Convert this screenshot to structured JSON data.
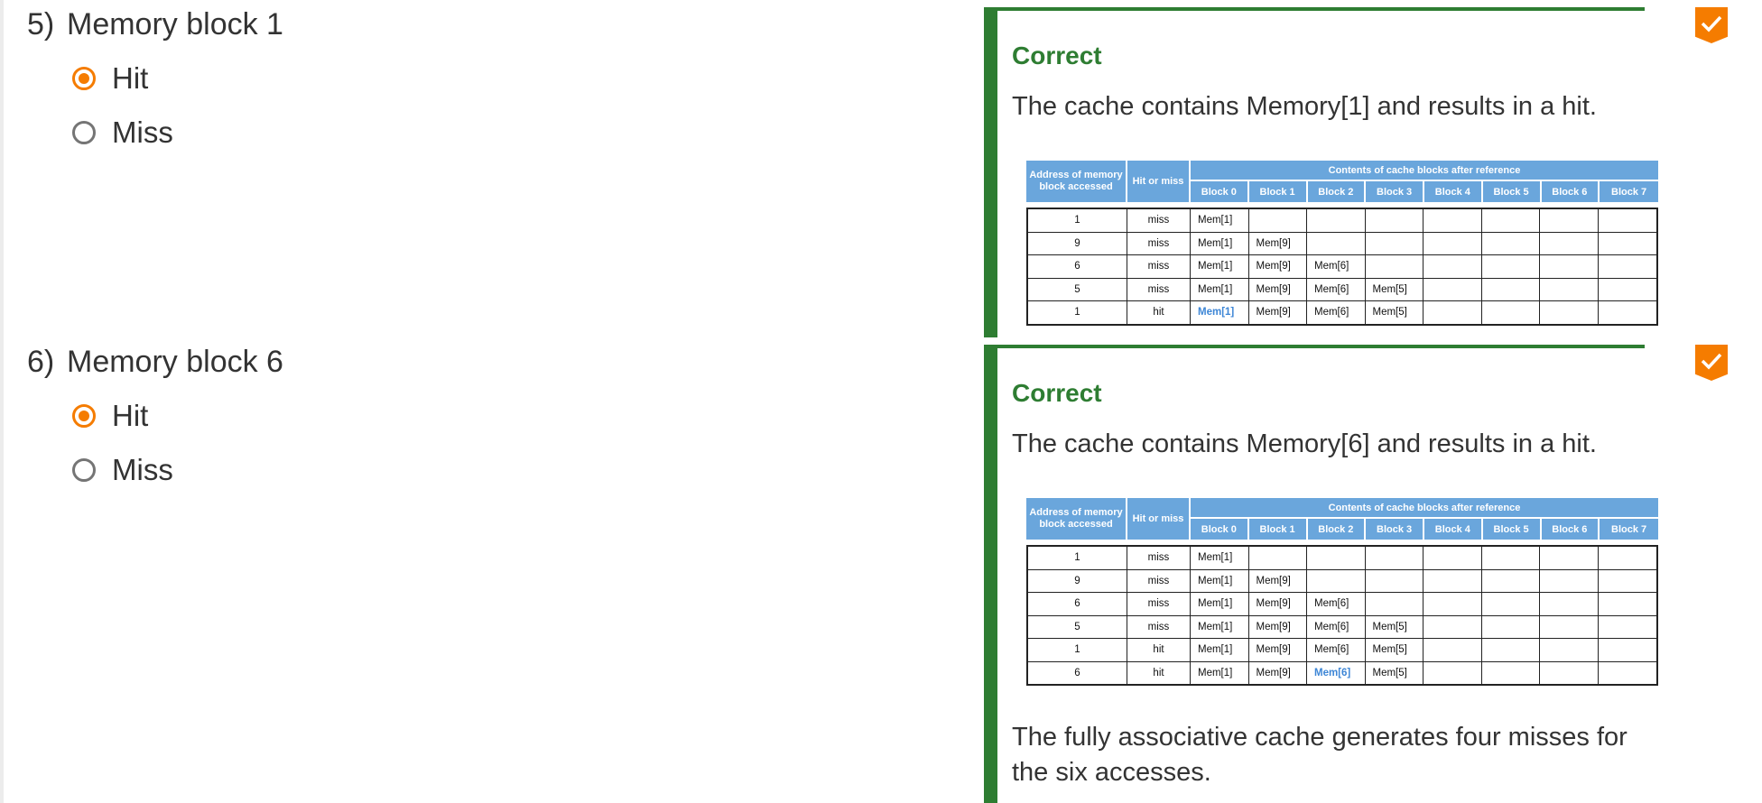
{
  "questions": [
    {
      "number": "5)",
      "title": "Memory block 1",
      "options": [
        {
          "label": "Hit",
          "selected": true
        },
        {
          "label": "Miss",
          "selected": false
        }
      ],
      "feedback": {
        "status": "Correct",
        "explanation": "The cache contains Memory[1] and results in a hit.",
        "table": {
          "col_address": "Address of memory block accessed",
          "col_hit_miss": "Hit or miss",
          "col_contents": "Contents of cache blocks after reference",
          "blocks": [
            "Block 0",
            "Block 1",
            "Block 2",
            "Block 3",
            "Block 4",
            "Block 5",
            "Block 6",
            "Block 7"
          ],
          "rows": [
            {
              "address": "1",
              "result": "miss",
              "cells": [
                "Mem[1]",
                "",
                "",
                "",
                "",
                "",
                "",
                ""
              ]
            },
            {
              "address": "9",
              "result": "miss",
              "cells": [
                "Mem[1]",
                "Mem[9]",
                "",
                "",
                "",
                "",
                "",
                ""
              ]
            },
            {
              "address": "6",
              "result": "miss",
              "cells": [
                "Mem[1]",
                "Mem[9]",
                "Mem[6]",
                "",
                "",
                "",
                "",
                ""
              ]
            },
            {
              "address": "5",
              "result": "miss",
              "cells": [
                "Mem[1]",
                "Mem[9]",
                "Mem[6]",
                "Mem[5]",
                "",
                "",
                "",
                ""
              ]
            },
            {
              "address": "1",
              "result": "hit",
              "cells": [
                "Mem[1]",
                "Mem[9]",
                "Mem[6]",
                "Mem[5]",
                "",
                "",
                "",
                ""
              ],
              "highlight_index": 0
            }
          ]
        }
      }
    },
    {
      "number": "6)",
      "title": "Memory block 6",
      "options": [
        {
          "label": "Hit",
          "selected": true
        },
        {
          "label": "Miss",
          "selected": false
        }
      ],
      "feedback": {
        "status": "Correct",
        "explanation": "The cache contains Memory[6] and results in a hit.",
        "extra": "The fully associative cache generates four misses for the six accesses.",
        "table": {
          "col_address": "Address of memory block accessed",
          "col_hit_miss": "Hit or miss",
          "col_contents": "Contents of cache blocks after reference",
          "blocks": [
            "Block 0",
            "Block 1",
            "Block 2",
            "Block 3",
            "Block 4",
            "Block 5",
            "Block 6",
            "Block 7"
          ],
          "rows": [
            {
              "address": "1",
              "result": "miss",
              "cells": [
                "Mem[1]",
                "",
                "",
                "",
                "",
                "",
                "",
                ""
              ]
            },
            {
              "address": "9",
              "result": "miss",
              "cells": [
                "Mem[1]",
                "Mem[9]",
                "",
                "",
                "",
                "",
                "",
                ""
              ]
            },
            {
              "address": "6",
              "result": "miss",
              "cells": [
                "Mem[1]",
                "Mem[9]",
                "Mem[6]",
                "",
                "",
                "",
                "",
                ""
              ]
            },
            {
              "address": "5",
              "result": "miss",
              "cells": [
                "Mem[1]",
                "Mem[9]",
                "Mem[6]",
                "Mem[5]",
                "",
                "",
                "",
                ""
              ]
            },
            {
              "address": "1",
              "result": "hit",
              "cells": [
                "Mem[1]",
                "Mem[9]",
                "Mem[6]",
                "Mem[5]",
                "",
                "",
                "",
                ""
              ]
            },
            {
              "address": "6",
              "result": "hit",
              "cells": [
                "Mem[1]",
                "Mem[9]",
                "Mem[6]",
                "Mem[5]",
                "",
                "",
                "",
                ""
              ],
              "highlight_index": 2
            }
          ]
        }
      }
    }
  ],
  "colors": {
    "accent_orange": "#f57c00",
    "correct_green": "#2e7d32",
    "table_header_blue": "#6aa6dc",
    "highlight_blue": "#3d86d6"
  },
  "icons": {
    "badge": "check-icon"
  }
}
